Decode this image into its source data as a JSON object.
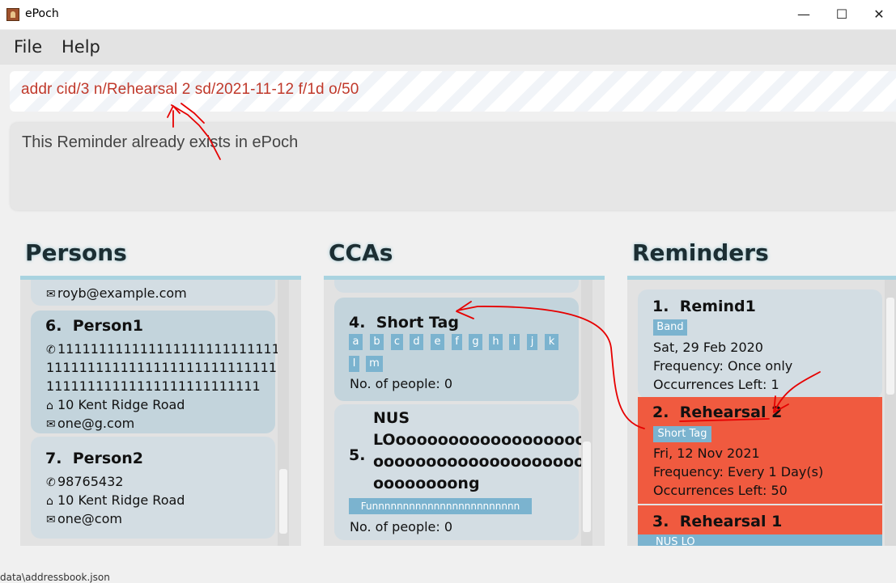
{
  "window": {
    "title": "ePoch",
    "minimize": "—",
    "maximize": "☐",
    "close": "✕"
  },
  "menu": {
    "file": "File",
    "help": "Help"
  },
  "command": {
    "value": "addr cid/3 n/Rehearsal 2 sd/2021-11-12 f/1d o/50"
  },
  "result": {
    "text": "This Reminder already exists in ePoch"
  },
  "panels": {
    "persons": "Persons",
    "ccas": "CCAs",
    "reminders": "Reminders"
  },
  "persons": {
    "partial_email": "royb@example.com",
    "items": [
      {
        "index": "6.",
        "name": "Person1",
        "phone_lines": [
          "1111111111111111111111111111",
          "1111111111111111111111111111",
          "11111111111111111111111111"
        ],
        "address": "10 Kent Ridge Road",
        "email": "one@g.com"
      },
      {
        "index": "7.",
        "name": "Person2",
        "phone": "98765432",
        "address": "10 Kent Ridge Road",
        "email": "one@com"
      }
    ]
  },
  "ccas": {
    "items": [
      {
        "index": "4.",
        "name": "Short Tag",
        "tags": [
          "a",
          "b",
          "c",
          "d",
          "e",
          "f",
          "g",
          "h",
          "i",
          "j",
          "k",
          "l",
          "m"
        ],
        "people": "No. of people: 0"
      },
      {
        "index": "5.",
        "name_lines": [
          "NUS",
          "LOoooooooooooooooooo",
          "oooooooooooooooooooo",
          "oooooooong"
        ],
        "tags": [
          "Funnnnnnnnnnnnnnnnnnnnnnnn"
        ],
        "people": "No. of people: 0"
      }
    ]
  },
  "reminders": {
    "items": [
      {
        "index": "1.",
        "name": "Remind1",
        "tag": "Band",
        "date": "Sat, 29 Feb 2020",
        "frequency": "Frequency: Once only",
        "occurrences": "Occurrences Left: 1"
      },
      {
        "index": "2.",
        "name": "Rehearsal 2",
        "tag": "Short Tag",
        "date": "Fri, 12 Nov 2021",
        "frequency": "Frequency: Every 1 Day(s)",
        "occurrences": "Occurrences Left: 50"
      },
      {
        "index": "3.",
        "name": "Rehearsal 1",
        "tag": "NUS LO"
      }
    ]
  },
  "status_bar": {
    "text": "data\\addressbook.json"
  },
  "icons": {
    "phone": "phone-icon",
    "home": "home-icon",
    "email": "email-icon"
  },
  "colors": {
    "selected_reminder": "#f05a3f",
    "command_text": "#c0392b",
    "panel_accent": "#a9d3e0",
    "tag": "#7bb3cf",
    "annotation": "#e60000"
  }
}
